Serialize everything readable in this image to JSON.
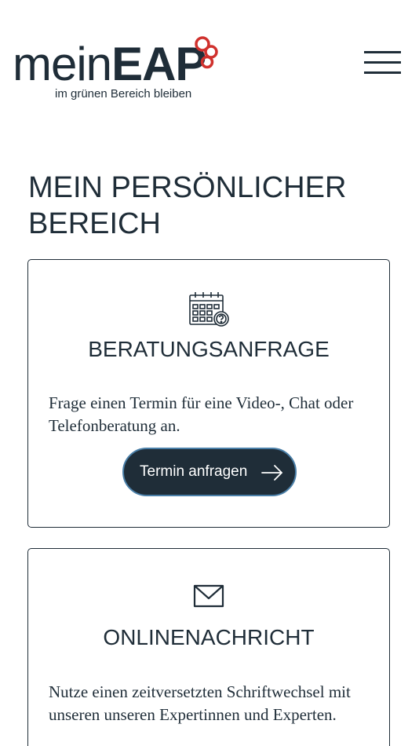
{
  "header": {
    "logo_light": "mein",
    "logo_bold": "EAP",
    "tagline": "im grünen Bereich bleiben",
    "menu_icon": "hamburger-menu-icon"
  },
  "page": {
    "title": "MEIN PERSÖNLICHER BEREICH"
  },
  "cards": [
    {
      "icon": "calendar-question-icon",
      "title": "BERATUNGSANFRAGE",
      "text": "Frage einen Termin für eine Video-, Chat oder Telefonberatung an.",
      "button_label": "Termin anfragen",
      "button_icon": "arrow-right-icon"
    },
    {
      "icon": "envelope-icon",
      "title": "ONLINENACHRICHT",
      "text": "Nutze einen zeitversetzten Schriftwechsel mit unseren unseren Expertinnen und Experten."
    }
  ],
  "colors": {
    "primary": "#1f2d38",
    "accent_red": "#d0312d",
    "button_border": "#4a7fa8",
    "background": "#ffffff"
  }
}
